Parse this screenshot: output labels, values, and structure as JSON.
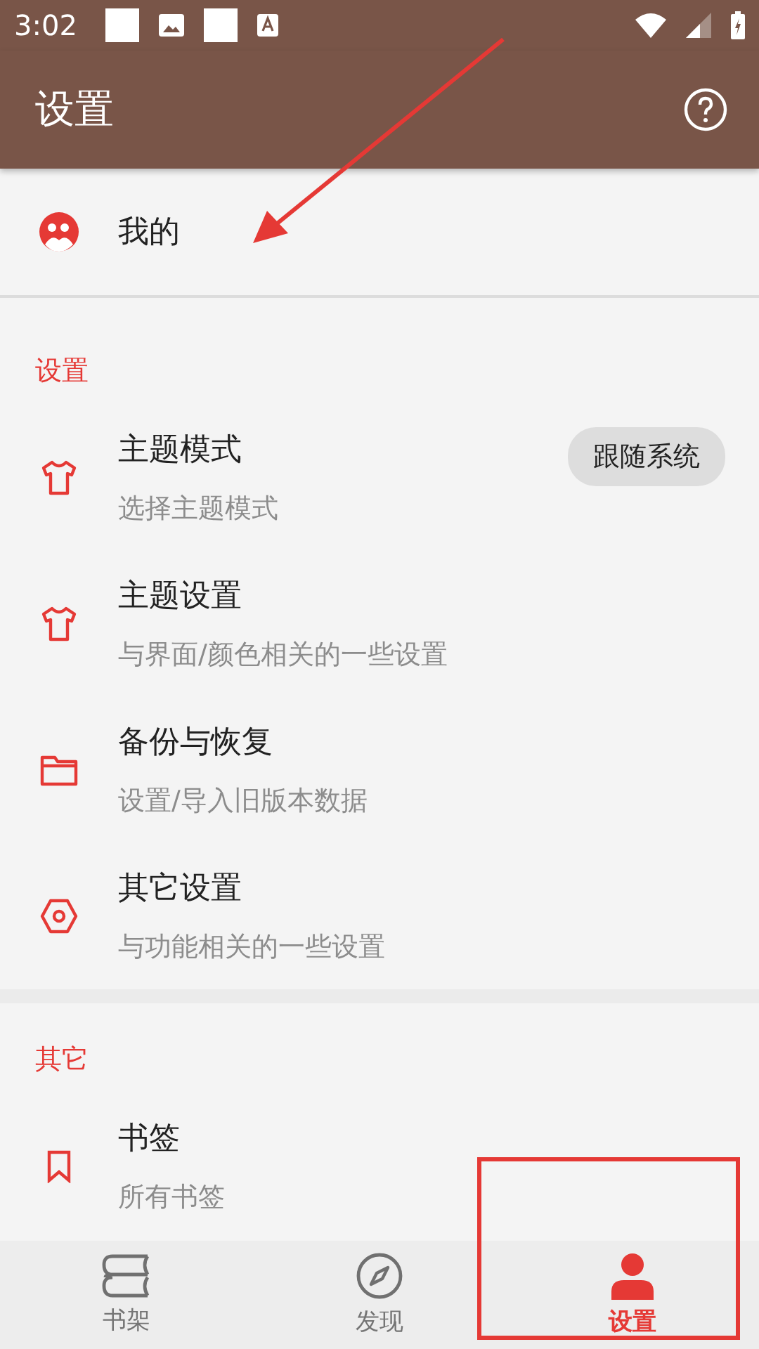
{
  "status_bar": {
    "time": "3:02"
  },
  "app_bar": {
    "title": "设置"
  },
  "profile": {
    "label": "我的"
  },
  "sections": [
    {
      "header": "设置",
      "items": [
        {
          "title": "主题模式",
          "subtitle": "选择主题模式",
          "value": "跟随系统"
        },
        {
          "title": "主题设置",
          "subtitle": "与界面/颜色相关的一些设置"
        },
        {
          "title": "备份与恢复",
          "subtitle": "设置/导入旧版本数据"
        },
        {
          "title": "其它设置",
          "subtitle": "与功能相关的一些设置"
        }
      ]
    },
    {
      "header": "其它",
      "items": [
        {
          "title": "书签",
          "subtitle": "所有书签"
        }
      ]
    }
  ],
  "bottom_nav": [
    {
      "label": "书架",
      "selected": false
    },
    {
      "label": "发现",
      "selected": false
    },
    {
      "label": "设置",
      "selected": true
    }
  ]
}
